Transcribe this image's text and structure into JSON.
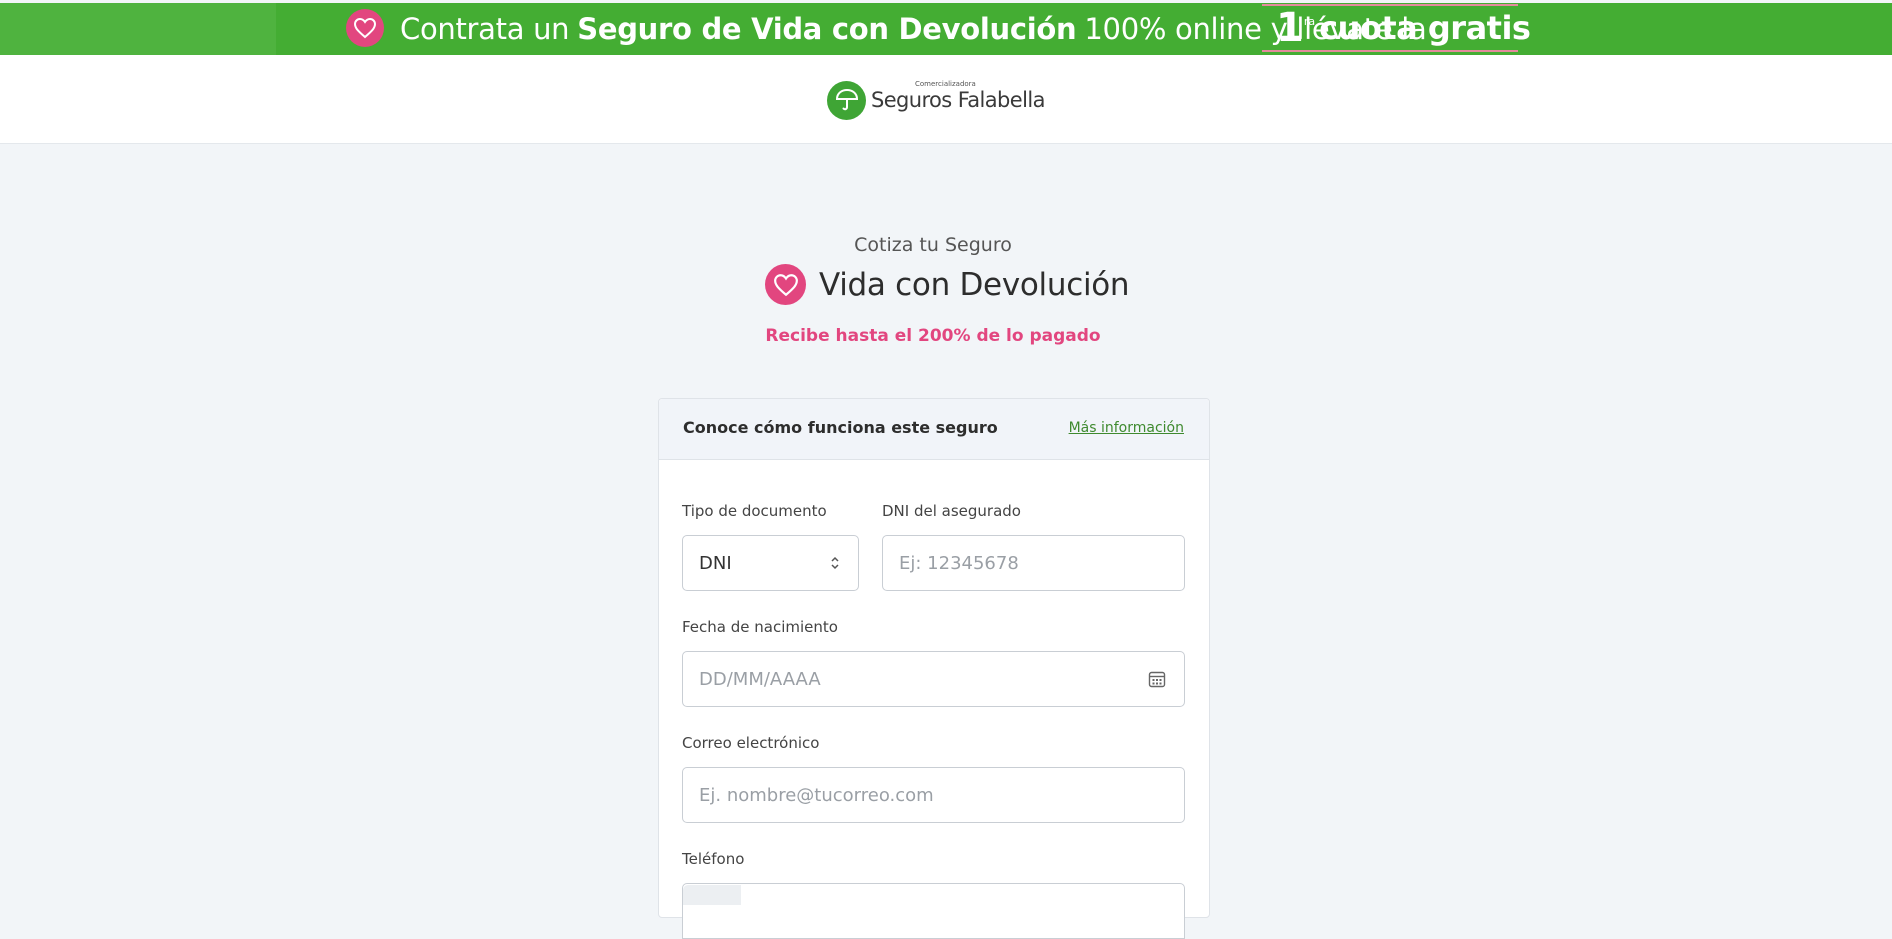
{
  "promo": {
    "lead": "Contrata un",
    "product": "Seguro de Vida con Devolución",
    "middle": "100% online y llévate la",
    "badge_number": "1",
    "badge_superscript": "ra",
    "badge_text": "cuota gratis",
    "icon": "heart-icon"
  },
  "header": {
    "logo_small": "Comercializadora",
    "logo_main": "Seguros Falabella",
    "logo_icon": "umbrella-icon"
  },
  "hero": {
    "subtitle": "Cotiza tu Seguro",
    "title": "Vida con Devolución",
    "tagline": "Recibe hasta el 200% de lo pagado"
  },
  "info": {
    "title": "Conoce cómo funciona este seguro",
    "link": "Más información"
  },
  "form": {
    "doc_type_label": "Tipo de documento",
    "doc_type_value": "DNI",
    "dni_label": "DNI del asegurado",
    "dni_placeholder": "Ej: 12345678",
    "birth_label": "Fecha de nacimiento",
    "birth_placeholder": "DD/MM/AAAA",
    "email_label": "Correo electrónico",
    "email_placeholder": "Ej. nombre@tucorreo.com",
    "phone_label": "Teléfono"
  },
  "colors": {
    "promo_green": "#44ad33",
    "brand_green": "#3fa535",
    "accent_pink": "#e2467f",
    "link_green": "#3f8a2f",
    "page_bg": "#f2f5f8"
  }
}
